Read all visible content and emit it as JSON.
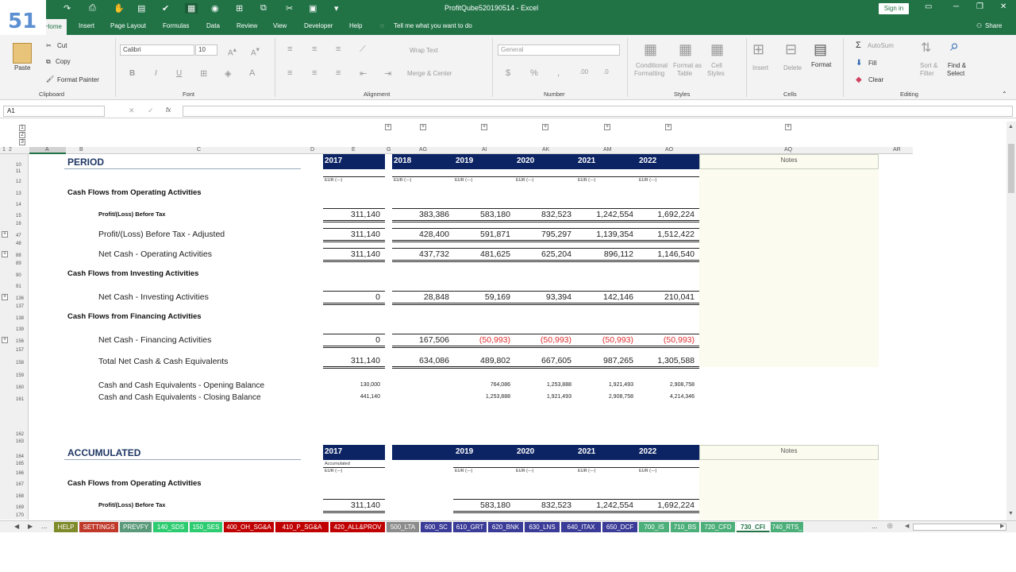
{
  "badge": "51",
  "window": {
    "title": "ProfitQube520190514  -  Excel",
    "sign_in": "Sign in",
    "share": "Share",
    "tell_me": "Tell me what you want to do"
  },
  "ribbon_tabs": [
    "Home",
    "Insert",
    "Page Layout",
    "Formulas",
    "Data",
    "Review",
    "View",
    "Developer",
    "Help"
  ],
  "clipboard": {
    "paste": "Paste",
    "cut": "Cut",
    "copy": "Copy",
    "format_painter": "Format Painter",
    "label": "Clipboard"
  },
  "font": {
    "name": "Calibri",
    "size": "10",
    "label": "Font"
  },
  "alignment": {
    "wrap": "Wrap Text",
    "merge": "Merge & Center",
    "label": "Alignment"
  },
  "number": {
    "format": "General",
    "label": "Number"
  },
  "styles": {
    "conditional": "Conditional",
    "conditional2": "Formatting",
    "format_as": "Format as",
    "format_as2": "Table",
    "cell": "Cell",
    "cell2": "Styles",
    "label": "Styles"
  },
  "cells": {
    "insert": "Insert",
    "delete": "Delete",
    "format": "Format",
    "label": "Cells"
  },
  "editing": {
    "autosum": "AutoSum",
    "fill": "Fill",
    "clear": "Clear",
    "sort": "Sort &",
    "sort2": "Filter",
    "find": "Find &",
    "find2": "Select",
    "label": "Editing"
  },
  "name_box": "A1",
  "outline_levels": [
    "1",
    "2",
    "3"
  ],
  "col_headers": [
    "1",
    "2",
    "A",
    "B",
    "C",
    "D",
    "E",
    "G",
    "AG",
    "AI",
    "AK",
    "AM",
    "AO",
    "AQ",
    "AR"
  ],
  "rows": [
    "10",
    "11",
    "12",
    "13",
    "14",
    "15",
    "16",
    "47",
    "48",
    "88",
    "89",
    "90",
    "91",
    "136",
    "137",
    "138",
    "139",
    "156",
    "157",
    "158",
    "159",
    "160",
    "161",
    "162",
    "163",
    "164",
    "165",
    "166",
    "167",
    "168",
    "169",
    "170"
  ],
  "period": {
    "title": "PERIOD",
    "notes": "Notes",
    "years": [
      "2017",
      "2018",
      "2019",
      "2020",
      "2021",
      "2022"
    ],
    "units": [
      "EUR (---)",
      "EUR (---)",
      "EUR (---)",
      "EUR (---)",
      "EUR (---)",
      "EUR (---)"
    ],
    "operating_head": "Cash Flows from Operating Activities",
    "investing_head": "Cash Flows from Investing Activities",
    "financing_head": "Cash Flows from Financing Activities",
    "lines": [
      {
        "label": "Profit/(Loss) Before Tax",
        "values": [
          "311,140",
          "383,386",
          "583,180",
          "832,523",
          "1,242,554",
          "1,692,224"
        ]
      },
      {
        "label": "Profit/(Loss) Before Tax - Adjusted",
        "values": [
          "311,140",
          "428,400",
          "591,871",
          "795,297",
          "1,139,354",
          "1,512,422"
        ]
      },
      {
        "label": "Net Cash - Operating Activities",
        "values": [
          "311,140",
          "437,732",
          "481,625",
          "625,204",
          "896,112",
          "1,146,540"
        ]
      },
      {
        "label": "Net Cash - Investing Activities",
        "values": [
          "0",
          "28,848",
          "59,169",
          "93,394",
          "142,146",
          "210,041"
        ]
      },
      {
        "label": "Net Cash - Financing Activities",
        "values": [
          "0",
          "167,506",
          "(50,993)",
          "(50,993)",
          "(50,993)",
          "(50,993)"
        ]
      },
      {
        "label": "Total Net Cash & Cash Equivalents",
        "values": [
          "311,140",
          "634,086",
          "489,802",
          "667,605",
          "987,265",
          "1,305,588"
        ]
      }
    ],
    "opening": {
      "label": "Cash and Cash Equivalents - Opening Balance",
      "values": [
        "130,000",
        "",
        "764,086",
        "1,253,888",
        "1,921,493",
        "2,908,758"
      ]
    },
    "closing": {
      "label": "Cash and Cash Equivalents - Closing Balance",
      "values": [
        "441,140",
        "",
        "1,253,888",
        "1,921,493",
        "2,908,758",
        "4,214,346"
      ]
    }
  },
  "accumulated": {
    "title": "ACCUMULATED",
    "notes": "Notes",
    "years": [
      "2017",
      "2019",
      "2020",
      "2021",
      "2022"
    ],
    "sub": "Accumulated",
    "units": [
      "EUR (---)",
      "EUR (---)",
      "EUR (---)",
      "EUR (---)",
      "EUR (---)"
    ],
    "operating_head": "Cash Flows from Operating Activities",
    "pbt": {
      "label": "Profit/(Loss) Before Tax",
      "values": [
        "311,140",
        "583,180",
        "832,523",
        "1,242,554",
        "1,692,224"
      ]
    }
  },
  "sheet_tabs": [
    {
      "name": "HELP",
      "color": "#7f8a2a"
    },
    {
      "name": "SETTINGS",
      "color": "#c0392b"
    },
    {
      "name": "PREVFY",
      "color": "#5a9a7a"
    },
    {
      "name": "140_SDS",
      "color": "#2ecc71"
    },
    {
      "name": "150_SES",
      "color": "#2ecc71"
    },
    {
      "name": "400_OH_SG&A",
      "color": "#c00000"
    },
    {
      "name": "410_P_SG&A",
      "color": "#c00000"
    },
    {
      "name": "420_ALL&PROV",
      "color": "#c00000"
    },
    {
      "name": "500_LTA",
      "color": "#8c8c8c"
    },
    {
      "name": "600_SC",
      "color": "#3b3b98"
    },
    {
      "name": "610_GRT",
      "color": "#3b3b98"
    },
    {
      "name": "620_BNK",
      "color": "#3b3b98"
    },
    {
      "name": "630_LNS",
      "color": "#3b3b98"
    },
    {
      "name": "640_ITAX",
      "color": "#3b3b98"
    },
    {
      "name": "650_DCF",
      "color": "#3b3b98"
    },
    {
      "name": "700_IS",
      "color": "#4caf7a"
    },
    {
      "name": "710_BS",
      "color": "#4caf7a"
    },
    {
      "name": "720_CFD",
      "color": "#4caf7a"
    },
    {
      "name": "730_CFI",
      "color": "#ffffff"
    },
    {
      "name": "740_RTS_",
      "color": "#4caf7a"
    }
  ]
}
